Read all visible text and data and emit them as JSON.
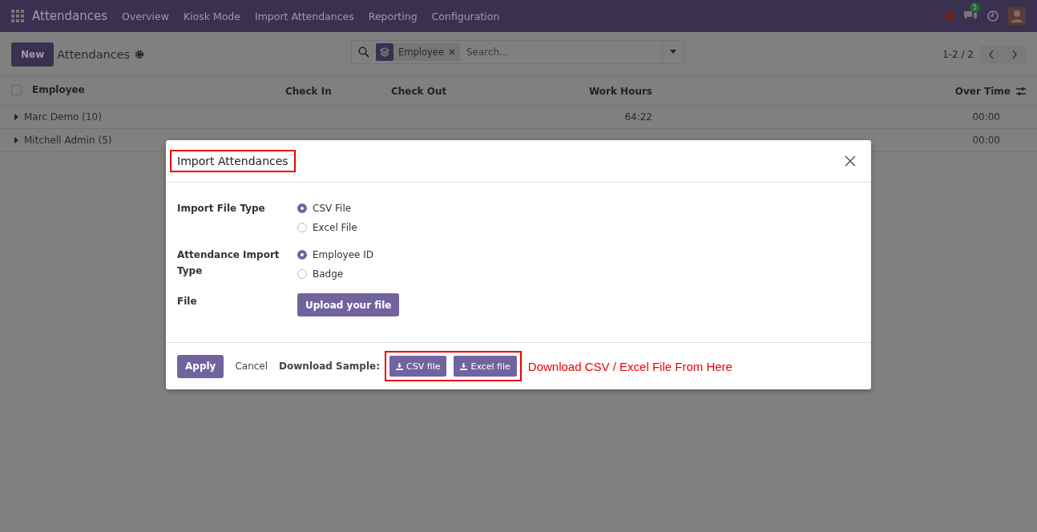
{
  "navbar": {
    "app_title": "Attendances",
    "menu": [
      "Overview",
      "Kiosk Mode",
      "Import Attendances",
      "Reporting",
      "Configuration"
    ],
    "message_count": "5"
  },
  "control_panel": {
    "new_button": "New",
    "title": "Attendances",
    "facet": "Employee",
    "search_placeholder": "Search...",
    "pager": "1-2 / 2"
  },
  "table": {
    "columns": [
      "Employee",
      "Check In",
      "Check Out",
      "Work Hours",
      "Over Time"
    ],
    "rows": [
      {
        "name": "Marc Demo (10)",
        "work_hours": "64:22",
        "over_time": "00:00"
      },
      {
        "name": "Mitchell Admin (5)",
        "over_time": "00:00"
      }
    ],
    "select_all": {
      "checked": false
    }
  },
  "dialog": {
    "title": "Import Attendances",
    "fields": [
      {
        "label": "Import File Type",
        "kind": "radio",
        "options": [
          {
            "label": "CSV File",
            "selected": true
          },
          {
            "label": "Excel File",
            "selected": false
          }
        ]
      },
      {
        "label": "Attendance Import Type",
        "kind": "radio",
        "options": [
          {
            "label": "Employee ID",
            "selected": true
          },
          {
            "label": "Badge",
            "selected": false
          }
        ]
      },
      {
        "label": "File",
        "kind": "upload",
        "button": "Upload your file"
      }
    ],
    "apply": "Apply",
    "cancel": "Cancel",
    "download_label": "Download Sample:",
    "download_buttons": [
      "CSV file",
      "Excel file"
    ],
    "annotation": "Download CSV / Excel File From Here"
  }
}
